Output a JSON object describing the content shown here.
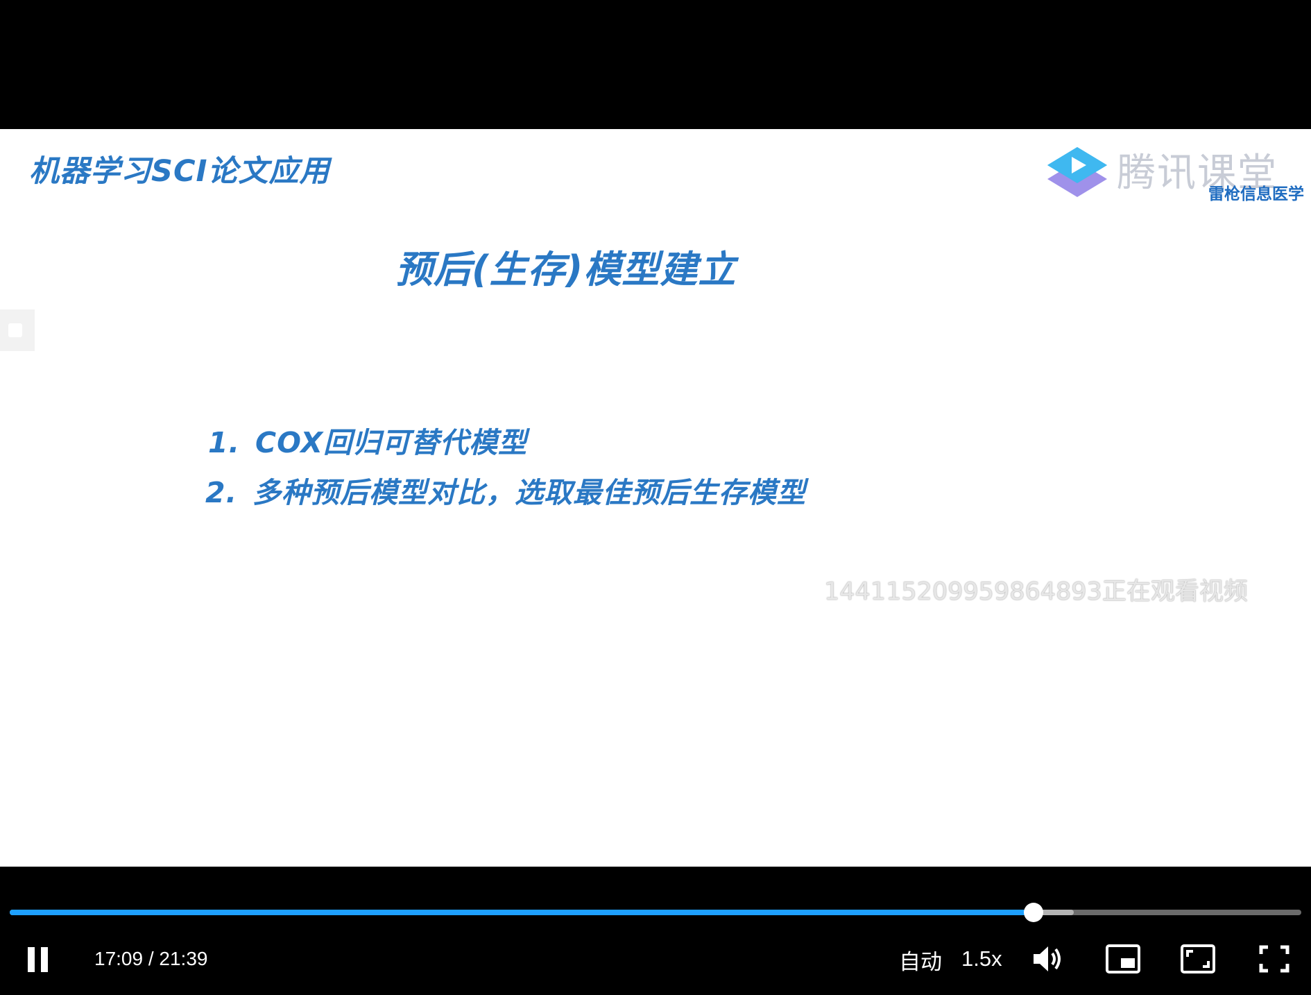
{
  "slide": {
    "header": "机器学习SCI论文应用",
    "logo": {
      "name": "腾讯课堂",
      "subtitle": "雷枪信息医学"
    },
    "title": "预后(生存)模型建立",
    "bullets": [
      {
        "number": "1.",
        "text": "COX回归可替代模型"
      },
      {
        "number": "2.",
        "text": "多种预后模型对比，选取最佳预后生存模型"
      }
    ],
    "watermark": "144115209959864893正在观看视频"
  },
  "controls": {
    "current_time": "17:09",
    "duration": "21:39",
    "time_display": "17:09 / 21:39",
    "progress_fraction": 0.7925,
    "buffered_fraction": 0.824,
    "quality_label": "自动",
    "speed_label": "1.5x",
    "icons": {
      "play_pause": "pause-icon",
      "volume": "volume-icon",
      "pip": "picture-in-picture-icon",
      "theater": "theater-mode-icon",
      "fullscreen": "fullscreen-icon"
    }
  },
  "colors": {
    "slide_text": "#2a78c4",
    "progress": "#1ea0ff",
    "background": "#000000"
  }
}
